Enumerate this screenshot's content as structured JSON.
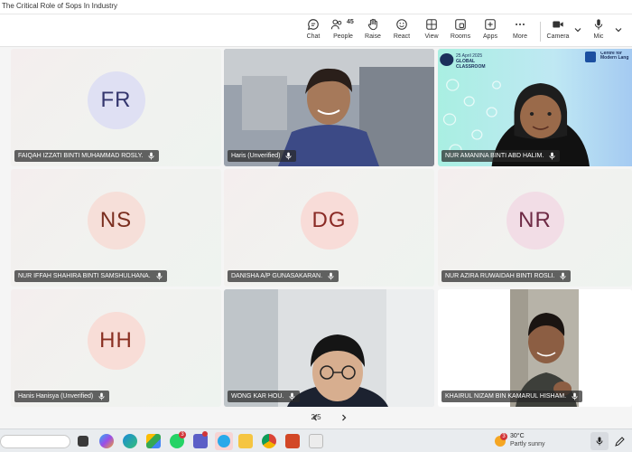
{
  "window": {
    "title": "The Critical Role of Sops In Industry"
  },
  "toolbar": {
    "chat": "Chat",
    "people": "People",
    "people_count": "45",
    "raise": "Raise",
    "react": "React",
    "view": "View",
    "rooms": "Rooms",
    "apps": "Apps",
    "more": "More",
    "camera": "Camera",
    "mic": "Mic"
  },
  "participants": [
    {
      "name": "FAIQAH IZZATI BINTI MUHAMMAD ROSLY.",
      "initials": "FR",
      "avatar_bg": "#dfe0f3",
      "avatar_fg": "#34366e"
    },
    {
      "name": "Haris (Unverified)",
      "video": true
    },
    {
      "name": "NUR AMANINA BINTI ABD HALIM.",
      "video": true
    },
    {
      "name": "NUR IFFAH SHAHIRA BINTI SAMSHULHANA.",
      "initials": "NS",
      "avatar_bg": "#f6dfd9",
      "avatar_fg": "#7a2e1f"
    },
    {
      "name": "DANISHA A/P GUNASAKARAN.",
      "initials": "DG",
      "avatar_bg": "#f8dcd8",
      "avatar_fg": "#8a2a25"
    },
    {
      "name": "NUR AZIRA RUWAIDAH BINTI ROSLI.",
      "initials": "NR",
      "avatar_bg": "#f2dde6",
      "avatar_fg": "#6e2a45"
    },
    {
      "name": "Hanis Hanisya (Unverified)",
      "initials": "HH",
      "avatar_bg": "#f8ddd7",
      "avatar_fg": "#8a2f22"
    },
    {
      "name": "WONG KAR HOU.",
      "video": true
    },
    {
      "name": "KHAIRUL NIZAM BIN KAMARUL HISHAM.",
      "video": true
    }
  ],
  "slide": {
    "date": "25 April 2025",
    "title": "GLOBAL CLASSROOM",
    "org": "Centre for Modern Lang"
  },
  "pager": {
    "label": "2/5"
  },
  "taskbar": {
    "weather_temp": "30°C",
    "weather_desc": "Partly sunny",
    "weather_badge": "3",
    "whatsapp_badge": "3"
  },
  "colors": {
    "accent": "#5b5fc7",
    "nametag_bg": "#282828"
  }
}
